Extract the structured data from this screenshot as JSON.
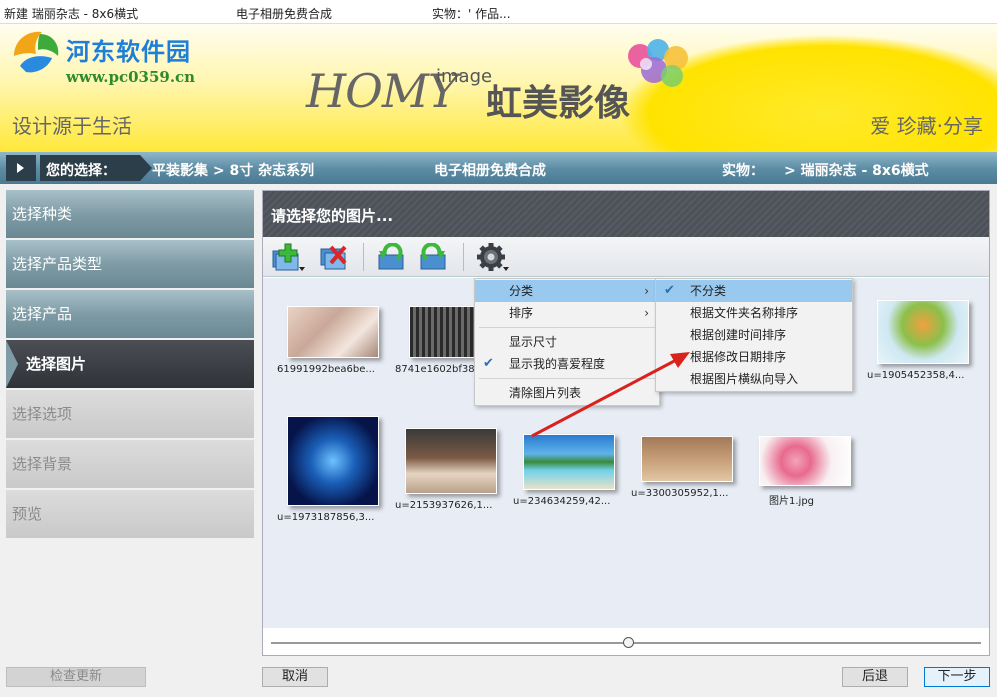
{
  "titlebar": {
    "title": "新建 瑞丽杂志 - 8x6横式",
    "mid": "电子相册免费合成",
    "right": "实物：' 作品..."
  },
  "watermark": {
    "site_name": "河东软件园",
    "url": "www.pc0359.cn"
  },
  "banner": {
    "slogan": "设计源于生活",
    "brand_en": "HOMY",
    "brand_image": "image",
    "brand_cn": "虹美影像",
    "motto": "爱  珍藏·分享"
  },
  "breadcrumb": {
    "label": "您的选择：",
    "path": "平装影集  >  8寸 杂志系列",
    "center": "电子相册免费合成",
    "object_label": "实物：",
    "object_value": ">  瑞丽杂志 - 8x6横式"
  },
  "sidebar": {
    "items": [
      {
        "label": "选择种类"
      },
      {
        "label": "选择产品类型"
      },
      {
        "label": "选择产品"
      },
      {
        "label": "选择图片"
      },
      {
        "label": "选择选项"
      },
      {
        "label": "选择背景"
      },
      {
        "label": "预览"
      }
    ]
  },
  "panel": {
    "title": "请选择您的图片..."
  },
  "toolbar": {
    "icons": [
      "add-image-icon",
      "remove-image-icon",
      "rotate-left-icon",
      "rotate-right-icon",
      "settings-gear-icon"
    ]
  },
  "context_menu": {
    "items": [
      {
        "label": "分类",
        "has_submenu": true,
        "highlighted": true
      },
      {
        "label": "排序",
        "has_submenu": true
      },
      {
        "label": "显示尺寸"
      },
      {
        "label": "显示我的喜爱程度",
        "checked": true
      },
      {
        "label": "清除图片列表"
      }
    ]
  },
  "submenu": {
    "items": [
      {
        "label": "不分类",
        "checked": true,
        "highlighted": true
      },
      {
        "label": "根据文件夹名称排序"
      },
      {
        "label": "根据创建时间排序"
      },
      {
        "label": "根据修改日期排序"
      },
      {
        "label": "根据图片横纵向导入"
      }
    ]
  },
  "thumbnails": [
    {
      "caption": "61991992bea6be..."
    },
    {
      "caption": "8741e1602bf38c..."
    },
    {
      "caption": "u=1905452358,4..."
    },
    {
      "caption": "u=1973187856,3..."
    },
    {
      "caption": "u=2153937626,1..."
    },
    {
      "caption": "u=234634259,42..."
    },
    {
      "caption": "u=3300305952,1..."
    },
    {
      "caption": "图片1.jpg"
    }
  ],
  "buttons": {
    "check_update": "检查更新",
    "cancel": "取消",
    "back": "后退",
    "next": "下一步"
  },
  "colors": {
    "accent_blue": "#0078d7",
    "menu_highlight": "#99c9ef",
    "nav_active": "#2f3237",
    "banner_yellow": "#ffe83a",
    "annotation_arrow": "#d9221c"
  }
}
